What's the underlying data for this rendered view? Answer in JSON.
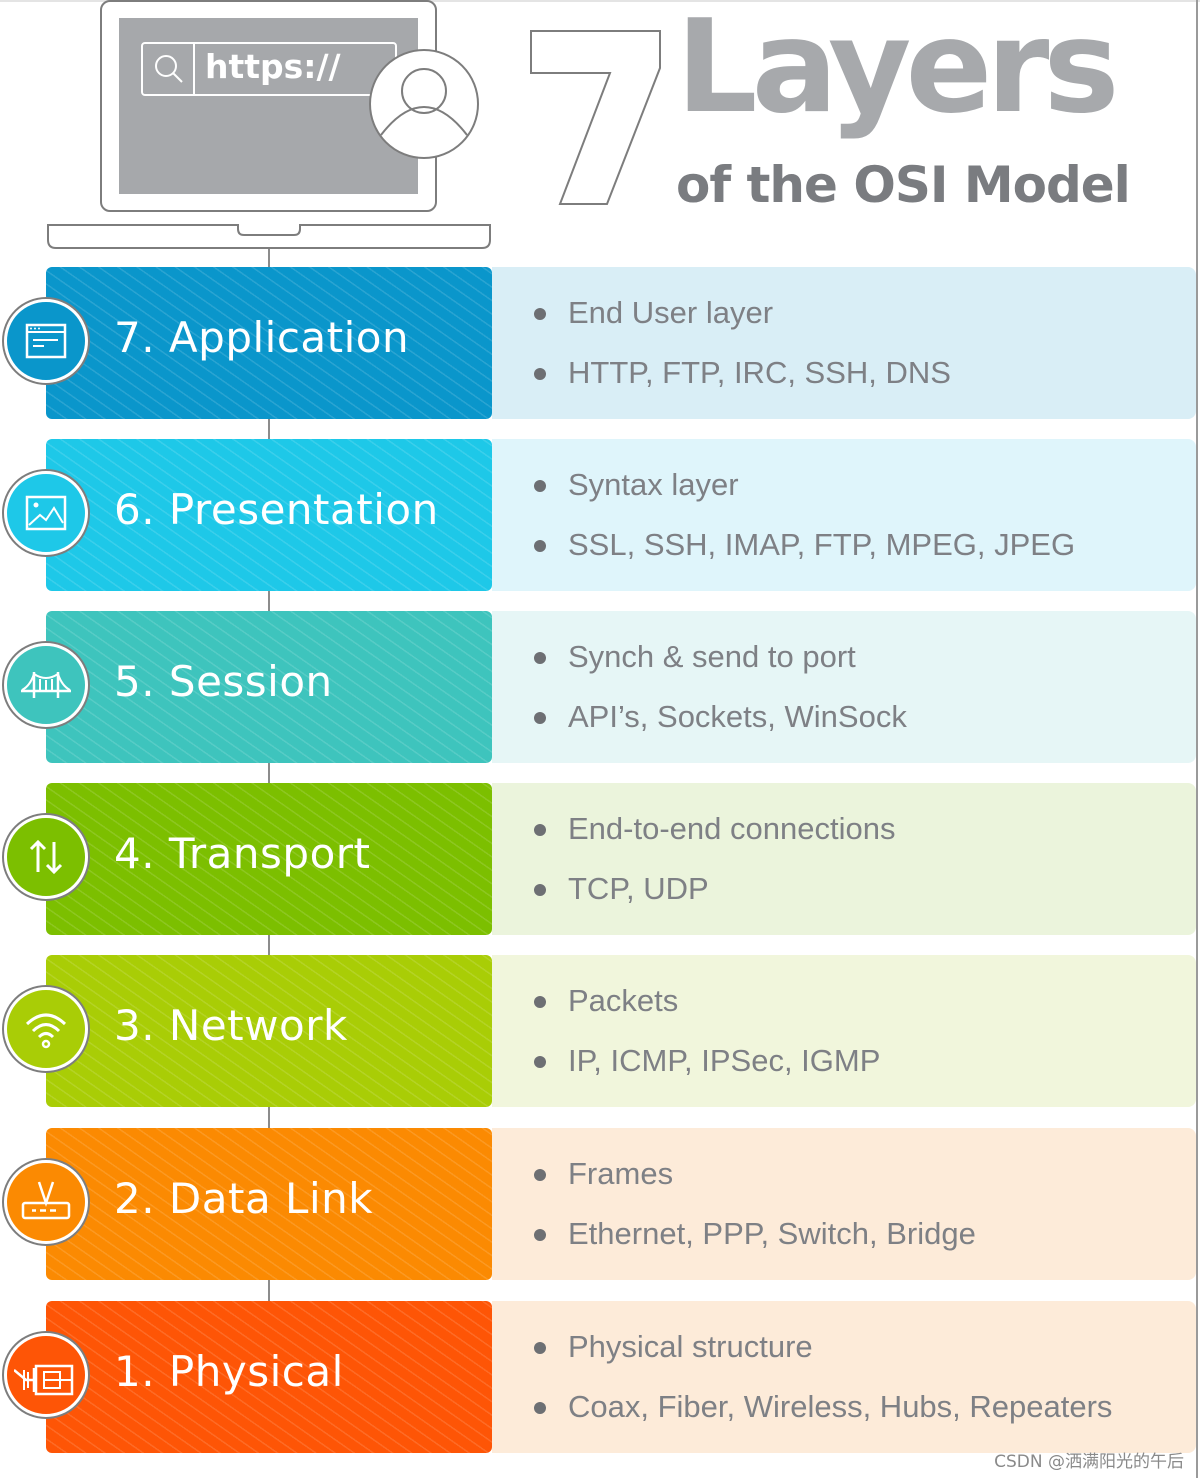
{
  "header": {
    "browser_url": "https://",
    "title_number": "7",
    "title_word": "Layers",
    "subtitle": "of the OSI Model"
  },
  "colors": {
    "title_gray": "#a7a9ac",
    "subtitle_gray": "#7a7c80",
    "bullet_text": "#7e8085"
  },
  "layers": [
    {
      "number": 7,
      "name": "7. Application",
      "icon": "browser-window-icon",
      "tile_color": "#0a96cb",
      "panel_color": "#d9eef6",
      "bullets": [
        "End User layer",
        "HTTP, FTP, IRC, SSH, DNS"
      ]
    },
    {
      "number": 6,
      "name": "6. Presentation",
      "icon": "image-icon",
      "tile_color": "#1ec8e8",
      "panel_color": "#dff5fb",
      "bullets": [
        "Syntax layer",
        "SSL, SSH, IMAP, FTP, MPEG, JPEG"
      ]
    },
    {
      "number": 5,
      "name": "5. Session",
      "icon": "bridge-icon",
      "tile_color": "#3ec4bd",
      "panel_color": "#e6f6f6",
      "bullets": [
        "Synch & send to port",
        "API’s, Sockets, WinSock"
      ]
    },
    {
      "number": 4,
      "name": "4. Transport",
      "icon": "up-down-arrows-icon",
      "tile_color": "#7cbf00",
      "panel_color": "#ebf4dc",
      "bullets": [
        "End-to-end connections",
        "TCP, UDP"
      ]
    },
    {
      "number": 3,
      "name": "3. Network",
      "icon": "wifi-icon",
      "tile_color": "#a9cd06",
      "panel_color": "#f1f6dc",
      "bullets": [
        "Packets",
        "IP, ICMP, IPSec, IGMP"
      ]
    },
    {
      "number": 2,
      "name": "2. Data Link",
      "icon": "router-icon",
      "tile_color": "#fb8a02",
      "panel_color": "#fdebd9",
      "bullets": [
        "Frames",
        "Ethernet, PPP, Switch, Bridge"
      ]
    },
    {
      "number": 1,
      "name": "1. Physical",
      "icon": "ethernet-cable-icon",
      "tile_color": "#fe5506",
      "panel_color": "#fdebd9",
      "bullets": [
        "Physical structure",
        "Coax, Fiber, Wireless, Hubs, Repeaters"
      ]
    }
  ],
  "watermark": "CSDN @洒满阳光的午后"
}
